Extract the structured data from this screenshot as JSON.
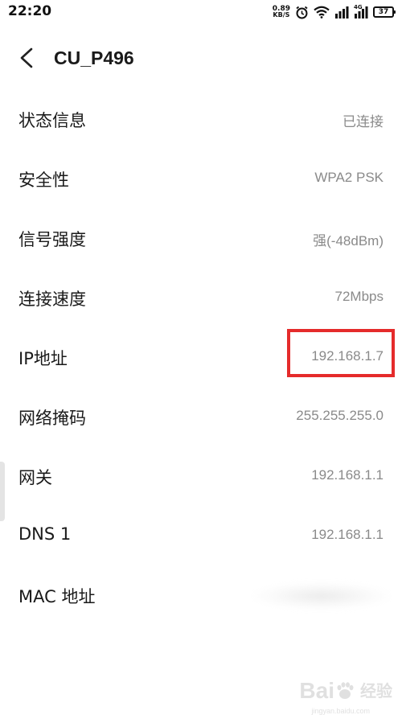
{
  "status_bar": {
    "time": "22:20",
    "net_speed_value": "0.89",
    "net_speed_unit": "KB/S",
    "network_type": "4G",
    "battery": "37"
  },
  "header": {
    "title": "CU_P496"
  },
  "rows": [
    {
      "label": "状态信息",
      "value": "已连接"
    },
    {
      "label": "安全性",
      "value": "WPA2 PSK"
    },
    {
      "label": "信号强度",
      "value": "强(-48dBm)"
    },
    {
      "label": "连接速度",
      "value": "72Mbps"
    },
    {
      "label": "IP地址",
      "value": "192.168.1.7"
    },
    {
      "label": "网络掩码",
      "value": "255.255.255.0"
    },
    {
      "label": "网关",
      "value": "192.168.1.1"
    },
    {
      "label": "DNS 1",
      "value": "192.168.1.1"
    },
    {
      "label": "MAC 地址",
      "value": ""
    }
  ],
  "watermark": {
    "logo": "Bai",
    "text": "经验",
    "url": "jingyan.baidu.com"
  },
  "colors": {
    "highlight": "#e52b2b",
    "value_text": "#8a8a8a",
    "label_text": "#1a1a1a"
  }
}
